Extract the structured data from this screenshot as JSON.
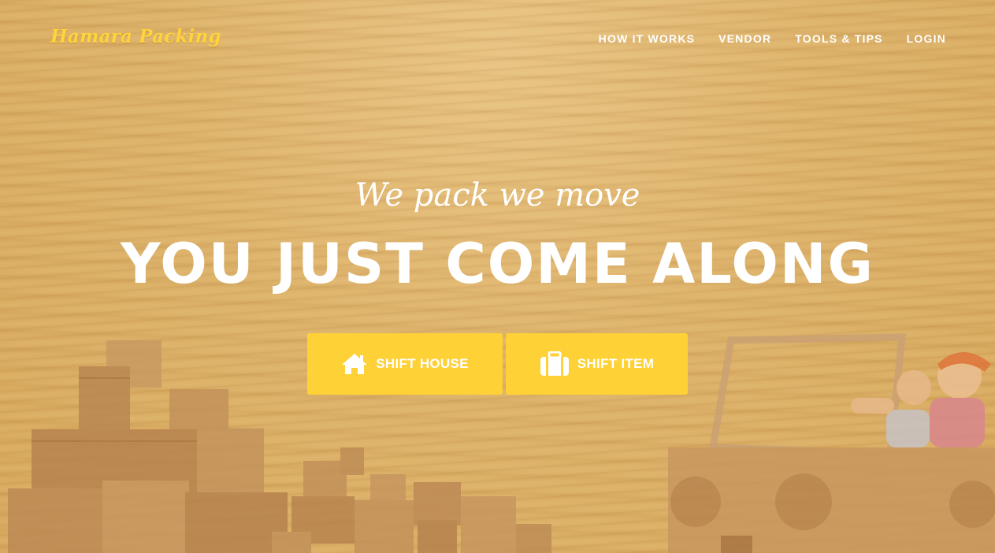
{
  "brand": {
    "name": "Hamara Packing"
  },
  "nav": {
    "items": [
      {
        "label": "HOW IT WORKS"
      },
      {
        "label": "VENDOR"
      },
      {
        "label": "TOOLS & TIPS"
      },
      {
        "label": "LOGIN"
      }
    ]
  },
  "hero": {
    "tagline": "We pack we move",
    "headline": "YOU JUST COME ALONG",
    "buttons": [
      {
        "label": "SHIFT HOUSE",
        "icon": "home-icon"
      },
      {
        "label": "SHIFT ITEM",
        "icon": "suitcase-icon"
      }
    ]
  },
  "colors": {
    "accent": "#fed136",
    "text": "#ffffff",
    "background": "#ddb26a"
  }
}
